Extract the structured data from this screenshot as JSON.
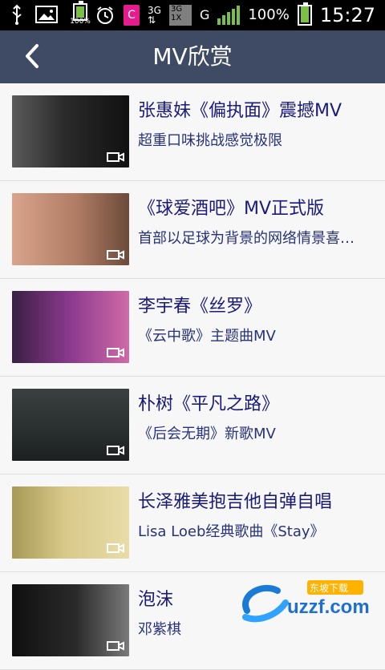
{
  "statusbar": {
    "network_type": "3G",
    "g_label": "G",
    "battery_percent": "100%",
    "time": "15:27",
    "app_badge": "C"
  },
  "header": {
    "title": "MV欣赏",
    "back_icon": "chevron-left-icon"
  },
  "list": [
    {
      "title": "张惠妹《偏执面》震撼MV",
      "subtitle": "超重口味挑战感觉极限",
      "thumb_colors": [
        "#3a3a3a",
        "#141414"
      ]
    },
    {
      "title": "《球爱酒吧》MV正式版",
      "subtitle": "首部以足球为背景的网络情景喜…",
      "thumb_colors": [
        "#a87760",
        "#e7b6a2"
      ]
    },
    {
      "title": "李宇春《丝罗》",
      "subtitle": "《云中歌》主题曲MV",
      "thumb_colors": [
        "#4b2b5a",
        "#b04a86"
      ]
    },
    {
      "title": "朴树《平凡之路》",
      "subtitle": "《后会无期》新歌MV",
      "thumb_colors": [
        "#2e3434",
        "#4b5353"
      ]
    },
    {
      "title": "长泽雅美抱吉他自弹自唱",
      "subtitle": "Lisa Loeb经典歌曲《Stay》",
      "thumb_colors": [
        "#8a7b3e",
        "#d7c57a"
      ]
    },
    {
      "title": "泡沫",
      "subtitle": "邓紫棋",
      "thumb_colors": [
        "#111111",
        "#3a3a3a"
      ]
    }
  ],
  "watermark": {
    "brand": "uzzf.com",
    "tag": "东坡下载"
  }
}
